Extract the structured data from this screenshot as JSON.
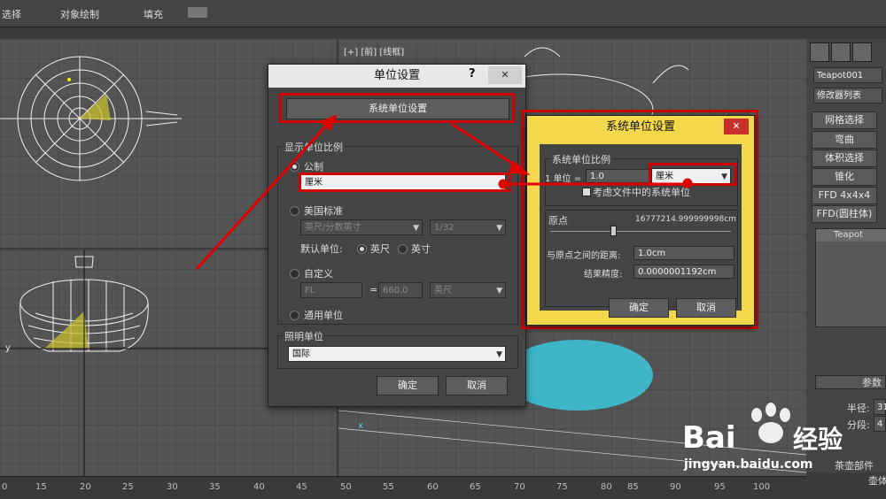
{
  "menubar": {
    "select": "选择",
    "obj_paint": "对象绘制",
    "fill": "填充"
  },
  "viewport": {
    "label": "[+] [前] [线框]",
    "axis_y": "y",
    "axis_x": "x"
  },
  "right_panel": {
    "object_name": "Teapot001",
    "modifier_list": "修改器列表",
    "buttons": [
      "网格选择",
      "弯曲",
      "体积选择",
      "锥化",
      "FFD 4x4x4",
      "FFD(圆柱体)"
    ],
    "stack_item": "Teapot",
    "rollout_title": "参数",
    "radius_label": "半径:",
    "radius_value": "31",
    "segments_label": "分段:",
    "segments_value": "4",
    "parts_label": "茶壶部件",
    "body_label": "壶体"
  },
  "timeline": {
    "ticks": [
      "0",
      "15",
      "20",
      "25",
      "30",
      "35",
      "40",
      "45",
      "50",
      "55",
      "60",
      "65",
      "70",
      "75",
      "80",
      "85",
      "90",
      "95",
      "100"
    ]
  },
  "units_dialog": {
    "title": "单位设置",
    "help": "?",
    "close": "✕",
    "system_units_button": "系统单位设置",
    "display_scale_group": "显示单位比例",
    "metric_label": "公制",
    "metric_value": "厘米",
    "us_label": "美国标准",
    "us_value": "英尺/分数英寸",
    "us_fraction": "1/32",
    "default_units_label": "默认单位:",
    "feet_label": "英尺",
    "inches_label": "英寸",
    "custom_label": "自定义",
    "custom_name": "FL",
    "custom_eq": "=",
    "custom_value": "660.0",
    "custom_unit": "英尺",
    "generic_label": "通用单位",
    "lighting_group": "照明单位",
    "lighting_value": "国际",
    "ok": "确定",
    "cancel": "取消"
  },
  "system_dialog": {
    "title": "系统单位设置",
    "close": "✕",
    "scale_group": "系统单位比例",
    "unit_label": "1 单位 =",
    "unit_value": "1.0",
    "unit_type": "厘米",
    "consider_files": "考虑文件中的系统单位",
    "origin_label": "原点",
    "origin_value": "16777214.999999998cm",
    "distance_label": "与原点之间的距离:",
    "distance_value": "1.0cm",
    "precision_label": "结果精度:",
    "precision_value": "0.0000001192cm",
    "ok": "确定",
    "cancel": "取消"
  },
  "watermark": {
    "brand": "Bai",
    "brand2": "经验",
    "url": "jingyan.baidu.com"
  },
  "colors": {
    "highlight_red": "#d10000",
    "system_dialog_bg": "#f2d84a",
    "teapot_blue": "#3fb6c8",
    "selection_yellow": "#e8e000"
  }
}
